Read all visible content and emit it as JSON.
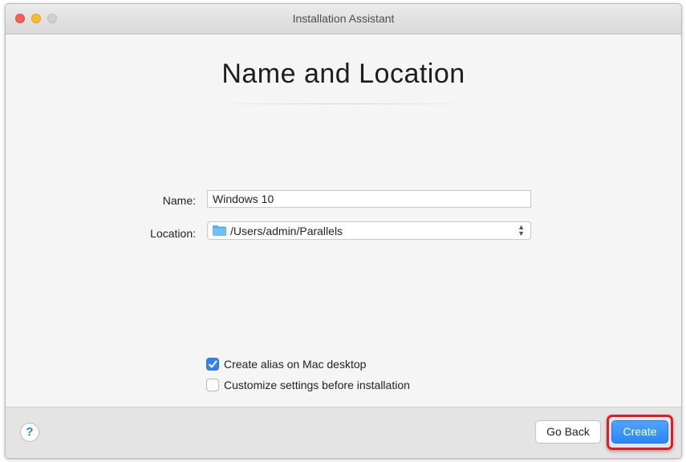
{
  "window": {
    "title": "Installation Assistant"
  },
  "page": {
    "heading": "Name and Location"
  },
  "form": {
    "name_label": "Name:",
    "name_value": "Windows 10",
    "location_label": "Location:",
    "location_value": "/Users/admin/Parallels",
    "location_icon": "folder-icon"
  },
  "options": [
    {
      "label": "Create alias on Mac desktop",
      "checked": true
    },
    {
      "label": "Customize settings before installation",
      "checked": false
    }
  ],
  "footer": {
    "help_label": "?",
    "go_back_label": "Go Back",
    "create_label": "Create"
  },
  "colors": {
    "accent": "#2f82f7",
    "highlight_box": "#e01b24"
  }
}
